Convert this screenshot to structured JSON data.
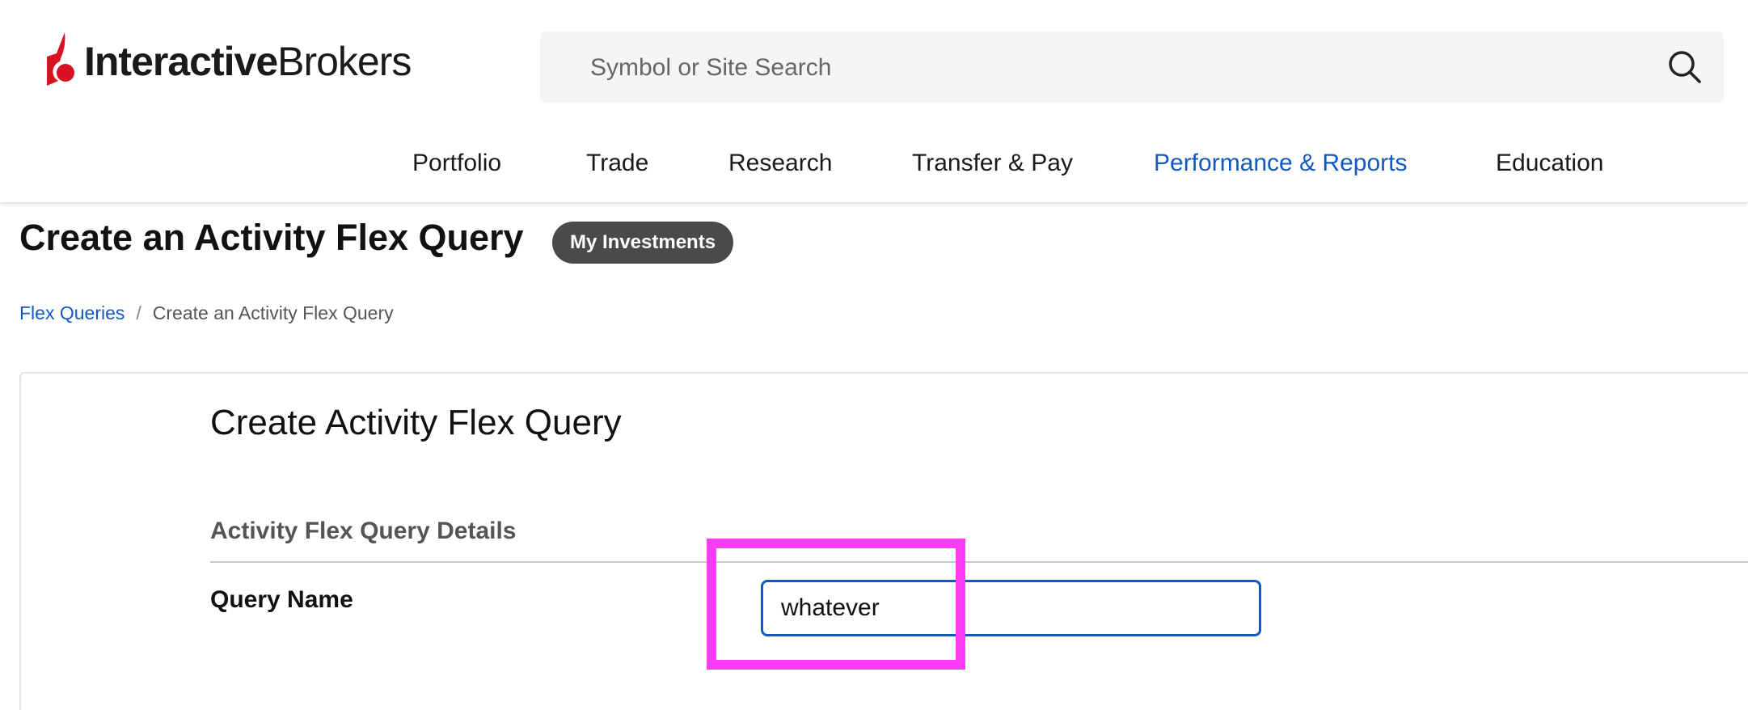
{
  "brand": {
    "name_bold": "Interactive",
    "name_light": "Brokers",
    "accent_color": "#d81222",
    "logo_icon": "ib-flame-logo"
  },
  "search": {
    "placeholder": "Symbol or Site Search",
    "icon": "search-icon"
  },
  "nav": {
    "items": [
      {
        "label": "Portfolio"
      },
      {
        "label": "Trade"
      },
      {
        "label": "Research"
      },
      {
        "label": "Transfer & Pay"
      },
      {
        "label": "Performance & Reports",
        "active": true
      },
      {
        "label": "Education"
      }
    ],
    "active_color": "#1358bf"
  },
  "page": {
    "title": "Create an Activity Flex Query",
    "badge": "My Investments"
  },
  "breadcrumb": {
    "items": [
      {
        "label": "Flex Queries",
        "link": true
      },
      {
        "label": "Create an Activity Flex Query",
        "link": false
      }
    ],
    "separator": "/"
  },
  "form": {
    "title": "Create Activity Flex Query",
    "section_heading": "Activity Flex Query Details",
    "fields": [
      {
        "label": "Query Name",
        "value": "whatever"
      }
    ]
  },
  "annotation": {
    "highlight_color": "#ff3cf3"
  }
}
